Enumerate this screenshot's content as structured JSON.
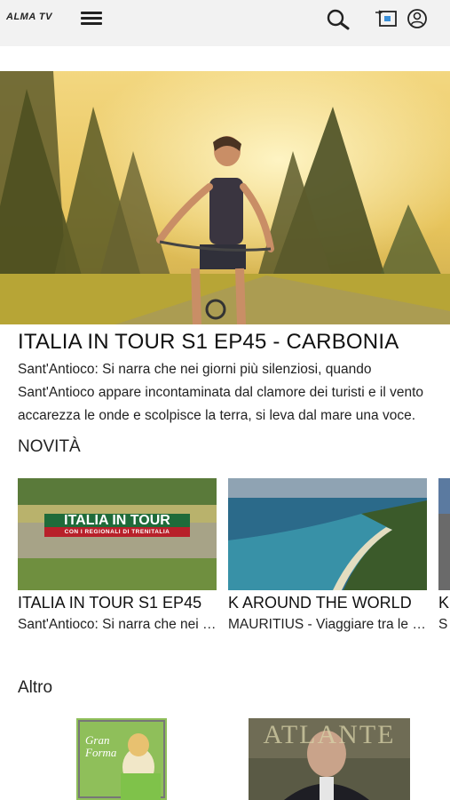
{
  "header": {
    "logo_text": "ALMA TV",
    "icons": [
      "menu-icon",
      "search-icon",
      "cast-icon",
      "account-icon"
    ]
  },
  "hero": {
    "title": "ITALIA IN TOUR S1 EP45 - CARBONIA",
    "description": "Sant'Antioco: Si narra che nei giorni più silenziosi, quando Sant'Antioco appare incontaminata dal clamore dei turisti e il vento accarezza le onde e scolpisce la terra, si leva dal mare una voce."
  },
  "sections": {
    "novita_title": "NOVITÀ",
    "altro_title": "Altro"
  },
  "novita": [
    {
      "title": "ITALIA IN TOUR S1 EP45",
      "subtitle": "Sant'Antioco: Si narra che nei giorni più silenziosi",
      "thumb_banner": "ITALIA IN TOUR",
      "thumb_sub": "CON I REGIONALI DI TRENITALIA"
    },
    {
      "title": "K AROUND THE WORLD",
      "subtitle": "MAURITIUS - Viaggiare tra le meraviglie"
    },
    {
      "title": "K",
      "subtitle": "S"
    }
  ],
  "altro": [
    {
      "thumb_text": "Gran Forma"
    },
    {
      "thumb_text": "ATLANTE"
    }
  ],
  "colors": {
    "topbar_bg": "#f2f2f2",
    "banner_red": "#b8202a",
    "banner_green": "#1f6b3a"
  }
}
